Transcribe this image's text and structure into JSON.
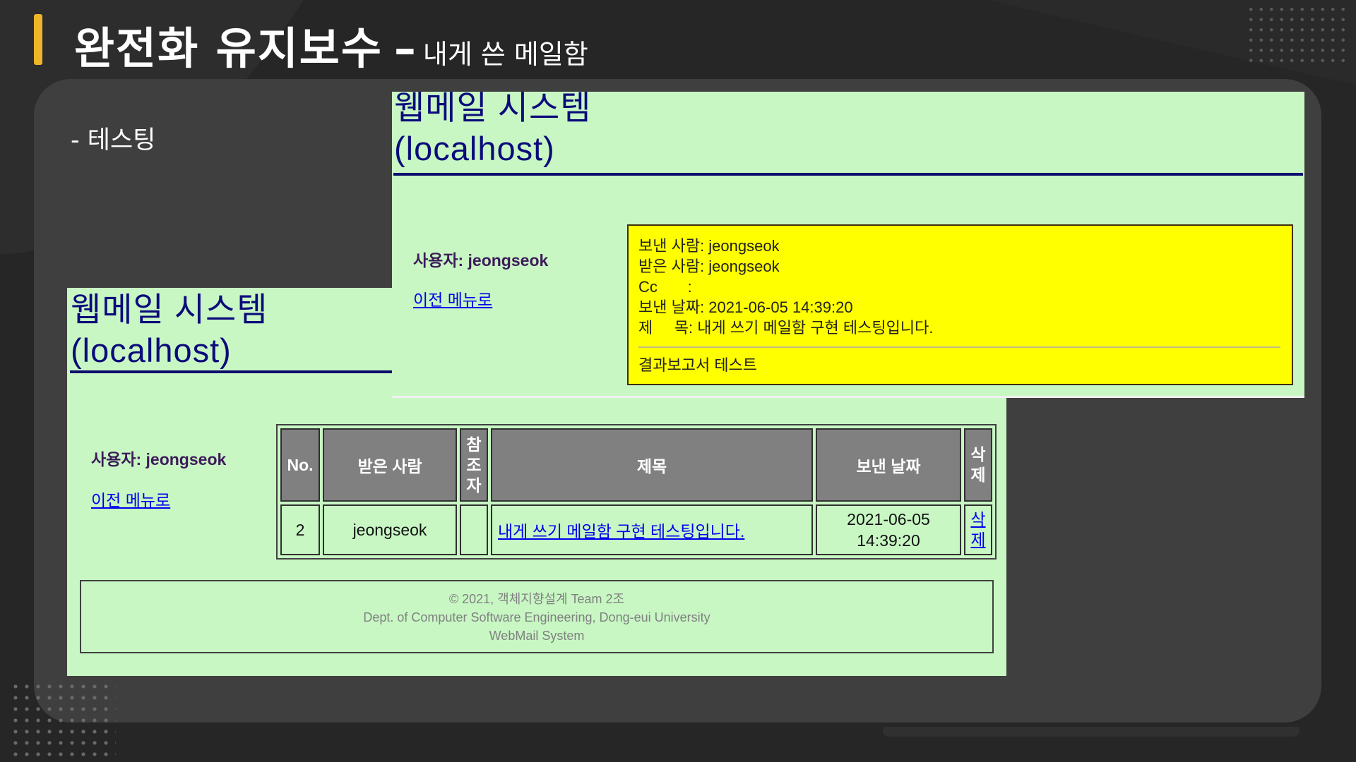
{
  "slide": {
    "title_main": "완전화 유지보수",
    "title_dash": "–",
    "title_sub": "내게 쓴 메일함",
    "bullet": "- 테스팅",
    "accent_color": "#f0b429"
  },
  "back_window": {
    "title_line1": "웹메일 시스템",
    "title_line2": "(localhost)",
    "user_label": "사용자: jeongseok",
    "prev_menu": "이전 메뉴로",
    "table": {
      "headers": [
        "No.",
        "받은 사람",
        "참\n조\n자",
        "제목",
        "보낸 날짜",
        "삭\n제"
      ],
      "rows": [
        {
          "no": "2",
          "recipient": "jeongseok",
          "cc": "",
          "subject": "내게 쓰기 메일함 구현 테스팅입니다.",
          "date_line1": "2021-06-05",
          "date_line2": "14:39:20",
          "delete_line1": "삭",
          "delete_line2": "제"
        }
      ]
    },
    "footer": {
      "line1": "© 2021, 객체지향설계 Team 2조",
      "line2": "Dept. of Computer Software Engineering, Dong-eui University",
      "line3": "WebMail System"
    }
  },
  "front_window": {
    "title_line1": "웹메일 시스템",
    "title_line2": "(localhost)",
    "user_label": "사용자: jeongseok",
    "prev_menu": "이전 메뉴로",
    "message": {
      "from": "보낸 사람: jeongseok",
      "to": "받은 사람: jeongseok",
      "cc": "Cc       :",
      "date": "보낸 날짜: 2021-06-05 14:39:20",
      "subject": "제     목: 내게 쓰기 메일함 구현 테스팅입니다.",
      "body": "결과보고서 테스트"
    }
  }
}
